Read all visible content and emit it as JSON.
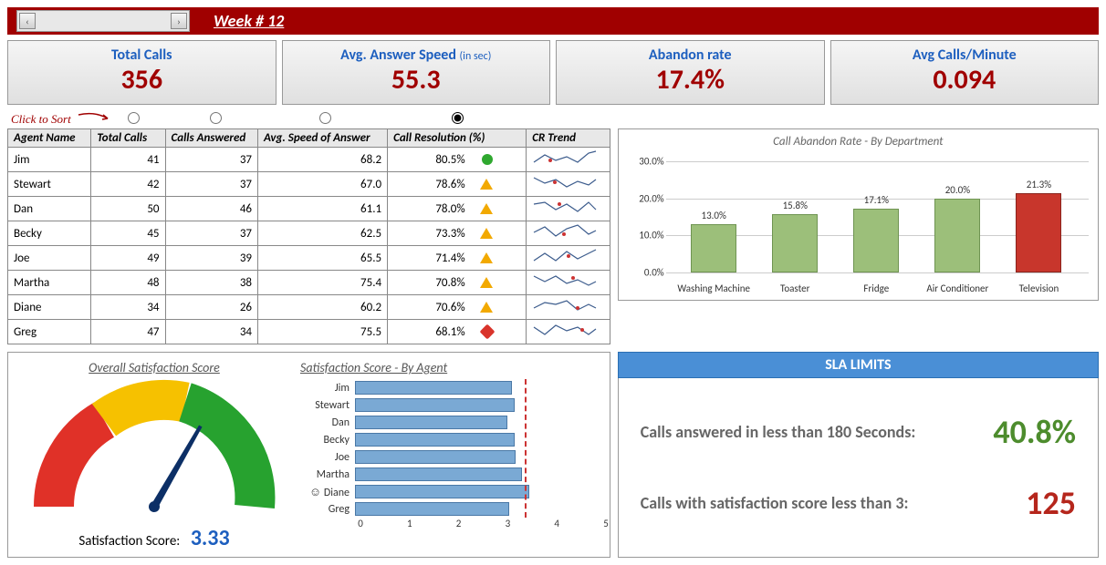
{
  "header": {
    "week_label": "Week # 12"
  },
  "kpis": [
    {
      "title": "Total Calls",
      "sub": "",
      "value": "356"
    },
    {
      "title": "Avg. Answer Speed",
      "sub": "(in sec)",
      "value": "55.3"
    },
    {
      "title": "Abandon rate",
      "sub": "",
      "value": "17.4%"
    },
    {
      "title": "Avg Calls/Minute",
      "sub": "",
      "value": "0.094"
    }
  ],
  "sort_hint": "Click to Sort",
  "table": {
    "headers": [
      "Agent Name",
      "Total Calls",
      "Calls Answered",
      "Avg. Speed of Answer",
      "Call Resolution (%)",
      "CR Trend"
    ],
    "sort_selected": 3,
    "rows": [
      {
        "name": "Jim",
        "tc": 41,
        "ca": 37,
        "speed": "68.2",
        "cr": "80.5%",
        "ind": "g"
      },
      {
        "name": "Stewart",
        "tc": 42,
        "ca": 37,
        "speed": "67.0",
        "cr": "78.6%",
        "ind": "y"
      },
      {
        "name": "Dan",
        "tc": 50,
        "ca": 46,
        "speed": "61.1",
        "cr": "78.0%",
        "ind": "y"
      },
      {
        "name": "Becky",
        "tc": 45,
        "ca": 37,
        "speed": "62.5",
        "cr": "73.3%",
        "ind": "y"
      },
      {
        "name": "Joe",
        "tc": 49,
        "ca": 39,
        "speed": "65.5",
        "cr": "71.4%",
        "ind": "y"
      },
      {
        "name": "Martha",
        "tc": 48,
        "ca": 38,
        "speed": "75.4",
        "cr": "70.8%",
        "ind": "y"
      },
      {
        "name": "Diane",
        "tc": 34,
        "ca": 26,
        "speed": "60.2",
        "cr": "70.6%",
        "ind": "y"
      },
      {
        "name": "Greg",
        "tc": 47,
        "ca": 34,
        "speed": "75.5",
        "cr": "68.1%",
        "ind": "r"
      }
    ]
  },
  "gauge": {
    "title": "Overall Satisfaction Score",
    "label": "Satisfaction Score:",
    "value": "3.33",
    "numeric": 3.33,
    "max": 5
  },
  "sat_by_agent": {
    "title": "Satisfaction Score - By Agent",
    "max": 5,
    "goal": 3.35,
    "agents": [
      {
        "name": "Jim",
        "smile": false,
        "val": 3.2
      },
      {
        "name": "Stewart",
        "smile": false,
        "val": 3.25
      },
      {
        "name": "Dan",
        "smile": false,
        "val": 3.1
      },
      {
        "name": "Becky",
        "smile": false,
        "val": 3.25
      },
      {
        "name": "Joe",
        "smile": false,
        "val": 3.28
      },
      {
        "name": "Martha",
        "smile": false,
        "val": 3.4
      },
      {
        "name": "Diane",
        "smile": true,
        "val": 3.55
      },
      {
        "name": "Greg",
        "smile": false,
        "val": 3.15
      }
    ]
  },
  "abandon": {
    "title": "Call Abandon Rate - By Department",
    "ymax": 30,
    "ticks": [
      "0.0%",
      "10.0%",
      "20.0%",
      "30.0%"
    ],
    "bars": [
      {
        "cat": "Washing Machine",
        "val": 13.0,
        "label": "13.0%",
        "red": false
      },
      {
        "cat": "Toaster",
        "val": 15.8,
        "label": "15.8%",
        "red": false
      },
      {
        "cat": "Fridge",
        "val": 17.1,
        "label": "17.1%",
        "red": false
      },
      {
        "cat": "Air Conditioner",
        "val": 20.0,
        "label": "20.0%",
        "red": false
      },
      {
        "cat": "Television",
        "val": 21.3,
        "label": "21.3%",
        "red": true
      }
    ]
  },
  "sla": {
    "title": "SLA LIMITS",
    "r1_text": "Calls answered in less than 180 Seconds:",
    "r1_val": "40.8%",
    "r2_text": "Calls with satisfaction score less than 3:",
    "r2_val": "125"
  },
  "chart_data": [
    {
      "type": "bar",
      "title": "Call Abandon Rate - By Department",
      "categories": [
        "Washing Machine",
        "Toaster",
        "Fridge",
        "Air Conditioner",
        "Television"
      ],
      "values": [
        13.0,
        15.8,
        17.1,
        20.0,
        21.3
      ],
      "ylabel": "",
      "xlabel": "",
      "ylim": [
        0,
        30
      ]
    },
    {
      "type": "bar",
      "title": "Satisfaction Score - By Agent",
      "orientation": "horizontal",
      "categories": [
        "Jim",
        "Stewart",
        "Dan",
        "Becky",
        "Joe",
        "Martha",
        "Diane",
        "Greg"
      ],
      "values": [
        3.2,
        3.25,
        3.1,
        3.25,
        3.28,
        3.4,
        3.55,
        3.15
      ],
      "xlim": [
        0,
        5
      ],
      "goal_line": 3.35
    },
    {
      "type": "gauge",
      "title": "Overall Satisfaction Score",
      "value": 3.33,
      "range": [
        0,
        5
      ]
    },
    {
      "type": "table",
      "title": "Agent Call Resolution",
      "columns": [
        "Agent Name",
        "Total Calls",
        "Calls Answered",
        "Avg. Speed of Answer",
        "Call Resolution (%)"
      ],
      "rows": [
        [
          "Jim",
          41,
          37,
          68.2,
          80.5
        ],
        [
          "Stewart",
          42,
          37,
          67.0,
          78.6
        ],
        [
          "Dan",
          50,
          46,
          61.1,
          78.0
        ],
        [
          "Becky",
          45,
          37,
          62.5,
          73.3
        ],
        [
          "Joe",
          49,
          39,
          65.5,
          71.4
        ],
        [
          "Martha",
          48,
          38,
          75.4,
          70.8
        ],
        [
          "Diane",
          34,
          26,
          60.2,
          70.6
        ],
        [
          "Greg",
          47,
          34,
          75.5,
          68.1
        ]
      ]
    }
  ]
}
